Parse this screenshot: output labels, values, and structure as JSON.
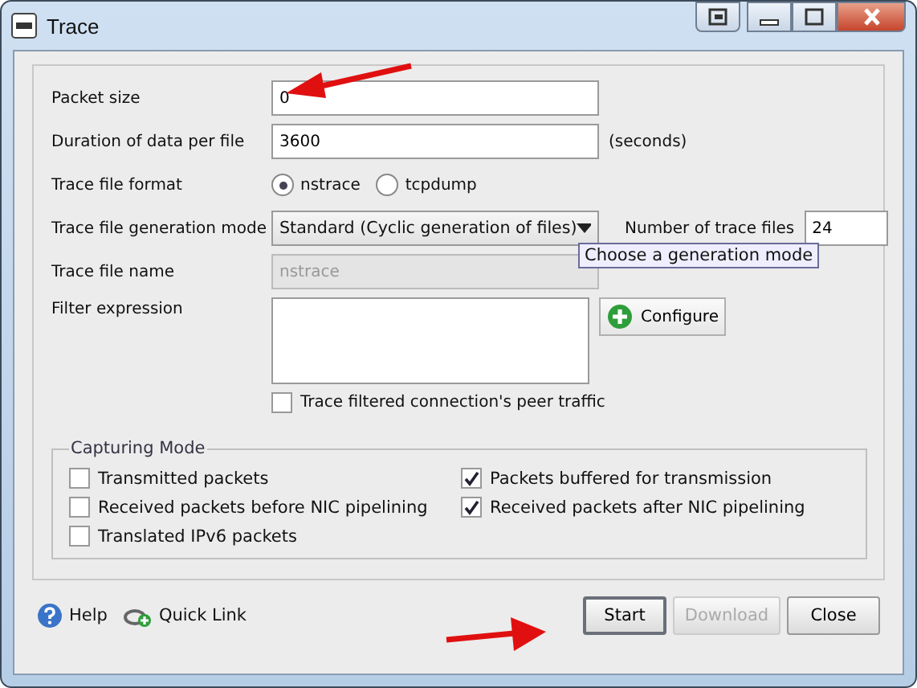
{
  "window": {
    "title": "Trace"
  },
  "fields": [
    {
      "kind": "text",
      "label": "Packet size",
      "value": "0",
      "disabled": false
    },
    {
      "kind": "text",
      "label": "Duration of data per file",
      "value": "3600",
      "suffix": "(seconds)",
      "disabled": false
    },
    {
      "kind": "radio",
      "label": "Trace file format",
      "options": [
        {
          "label": "nstrace",
          "selected": true
        },
        {
          "label": "tcpdump",
          "selected": false
        }
      ]
    },
    {
      "kind": "select",
      "label": "Trace file generation mode",
      "value": "Standard (Cyclic generation of files)",
      "extra_label": "Number of trace files",
      "extra_value": "24"
    },
    {
      "kind": "text",
      "label": "Trace file name",
      "value": "nstrace",
      "disabled": true
    },
    {
      "kind": "textarea",
      "label": "Filter expression",
      "button": "Configure"
    }
  ],
  "peer_traffic": {
    "label": "Trace filtered connection's peer traffic",
    "checked": false
  },
  "tooltip": "Choose a generation mode",
  "capturing_mode": {
    "title": "Capturing Mode",
    "options": [
      {
        "label": "Transmitted packets",
        "checked": false
      },
      {
        "label": "Packets buffered for transmission",
        "checked": true
      },
      {
        "label": "Received packets before NIC pipelining",
        "checked": false
      },
      {
        "label": "Received packets after NIC pipelining",
        "checked": true
      },
      {
        "label": "Translated IPv6 packets",
        "checked": false
      }
    ]
  },
  "links": [
    {
      "kind": "help",
      "label": "Help"
    },
    {
      "kind": "quicklink",
      "label": "Quick Link"
    }
  ],
  "buttons": [
    {
      "label": "Start",
      "disabled": false,
      "focused": true
    },
    {
      "label": "Download",
      "disabled": true,
      "focused": false
    },
    {
      "label": "Close",
      "disabled": false,
      "focused": false
    }
  ]
}
